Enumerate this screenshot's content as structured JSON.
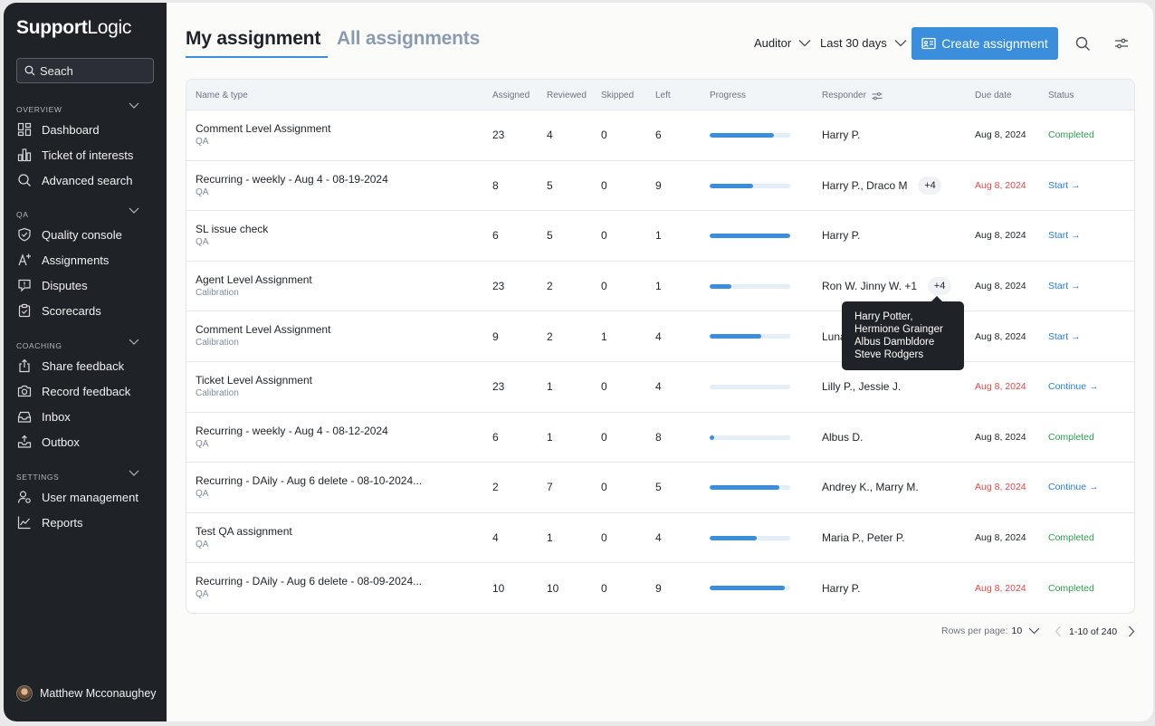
{
  "sidebar": {
    "logo_bold": "Support",
    "logo_rest": "Logic",
    "search_label": "Seach",
    "sections": [
      {
        "label": "OVERVIEW",
        "items": [
          {
            "label": "Dashboard",
            "icon": "dashboard-icon"
          },
          {
            "label": "Ticket of interests",
            "icon": "bar-chart-icon"
          },
          {
            "label": "Advanced search",
            "icon": "search-icon"
          }
        ]
      },
      {
        "label": "QA",
        "items": [
          {
            "label": "Quality console",
            "icon": "shield-check-icon"
          },
          {
            "label": "Assignments",
            "icon": "assignment-icon"
          },
          {
            "label": "Disputes",
            "icon": "dispute-icon"
          },
          {
            "label": "Scorecards",
            "icon": "clipboard-icon"
          }
        ]
      },
      {
        "label": "COACHING",
        "items": [
          {
            "label": "Share feedback",
            "icon": "share-icon"
          },
          {
            "label": "Record feedback",
            "icon": "camera-icon"
          },
          {
            "label": "Inbox",
            "icon": "inbox-icon"
          },
          {
            "label": "Outbox",
            "icon": "outbox-icon"
          }
        ]
      },
      {
        "label": "SETTINGS",
        "items": [
          {
            "label": "User management",
            "icon": "user-gear-icon"
          },
          {
            "label": "Reports",
            "icon": "line-chart-icon"
          }
        ]
      }
    ],
    "user_name": "Matthew Mcconaughey"
  },
  "header": {
    "tab_active": "My assignment",
    "tab_inactive": "All assignments",
    "role_filter": "Auditor",
    "date_filter": "Last 30 days",
    "create_label": "Create assignment"
  },
  "table": {
    "columns": [
      "Name & type",
      "Assigned",
      "Reviewed",
      "Skipped",
      "Left",
      "Progress",
      "Responder",
      "Due date",
      "Status"
    ],
    "rows": [
      {
        "name": "Comment Level Assignment",
        "type": "QA",
        "assigned": "23",
        "reviewed": "4",
        "skipped": "0",
        "left": "6",
        "progress": 0.8,
        "responder": "Harry P.",
        "extra": "",
        "due": "Aug 8, 2024",
        "due_late": false,
        "status": "Completed",
        "status_kind": "done"
      },
      {
        "name": "Recurring - weekly - Aug 4 - 08-19-2024",
        "type": "QA",
        "assigned": "8",
        "reviewed": "5",
        "skipped": "0",
        "left": "9",
        "progress": 0.54,
        "responder": "Harry P., Draco M",
        "extra": "+4",
        "due": "Aug 8, 2024",
        "due_late": true,
        "status": "Start →",
        "status_kind": "action"
      },
      {
        "name": "SL issue check",
        "type": "QA",
        "assigned": "6",
        "reviewed": "5",
        "skipped": "0",
        "left": "1",
        "progress": 1.0,
        "responder": "Harry P.",
        "extra": "",
        "due": "Aug 8, 2024",
        "due_late": false,
        "status": "Start →",
        "status_kind": "action"
      },
      {
        "name": "Agent Level Assignment",
        "type": "Calibration",
        "assigned": "23",
        "reviewed": "2",
        "skipped": "0",
        "left": "1",
        "progress": 0.27,
        "responder": "Ron W. Jinny W. +1",
        "extra": "+4",
        "due": "Aug 8, 2024",
        "due_late": false,
        "status": "Start →",
        "status_kind": "action"
      },
      {
        "name": "Comment Level Assignment",
        "type": "Calibration",
        "assigned": "9",
        "reviewed": "2",
        "skipped": "1",
        "left": "4",
        "progress": 0.64,
        "responder": "Luna",
        "extra": "",
        "due": "Aug 8, 2024",
        "due_late": false,
        "status": "Start →",
        "status_kind": "action"
      },
      {
        "name": "Ticket Level Assignment",
        "type": "Calibration",
        "assigned": "23",
        "reviewed": "1",
        "skipped": "0",
        "left": "4",
        "progress": 0.0,
        "responder": "Lilly P., Jessie J.",
        "extra": "",
        "due": "Aug 8, 2024",
        "due_late": true,
        "status": "Continue →",
        "status_kind": "action"
      },
      {
        "name": "Recurring - weekly - Aug 4 - 08-12-2024",
        "type": "QA",
        "assigned": "6",
        "reviewed": "1",
        "skipped": "0",
        "left": "8",
        "progress": 0.06,
        "responder": "Albus D.",
        "extra": "",
        "due": "Aug 8, 2024",
        "due_late": false,
        "status": "Completed",
        "status_kind": "done"
      },
      {
        "name": "Recurring - DAily - Aug 6 delete - 08-10-2024...",
        "type": "QA",
        "assigned": "2",
        "reviewed": "7",
        "skipped": "0",
        "left": "5",
        "progress": 0.87,
        "responder": "Andrey K., Marry M.",
        "extra": "",
        "due": "Aug 8, 2024",
        "due_late": true,
        "status": "Continue →",
        "status_kind": "action"
      },
      {
        "name": "Test QA assignment",
        "type": "QA",
        "assigned": "4",
        "reviewed": "1",
        "skipped": "0",
        "left": "4",
        "progress": 0.58,
        "responder": "Maria P., Peter P.",
        "extra": "",
        "due": "Aug 8, 2024",
        "due_late": false,
        "status": "Completed",
        "status_kind": "done"
      },
      {
        "name": "Recurring - DAily - Aug 6 delete - 08-09-2024...",
        "type": "QA",
        "assigned": "10",
        "reviewed": "10",
        "skipped": "0",
        "left": "9",
        "progress": 0.93,
        "responder": "Harry P.",
        "extra": "",
        "due": "Aug 8, 2024",
        "due_late": true,
        "status": "Completed",
        "status_kind": "done"
      }
    ]
  },
  "tooltip": {
    "lines": [
      "Harry Potter,",
      "Hermione Grainger",
      "Albus Dambldore",
      "Steve Rodgers"
    ]
  },
  "pagination": {
    "rows_label": "Rows per page:",
    "rows_value": "10",
    "range": "1-10 of 240"
  },
  "colors": {
    "accent": "#3a8edb",
    "sidebar_bg": "#1f2227",
    "late": "#e0494b",
    "completed": "#2f9a50",
    "action": "#2b7fd1"
  }
}
